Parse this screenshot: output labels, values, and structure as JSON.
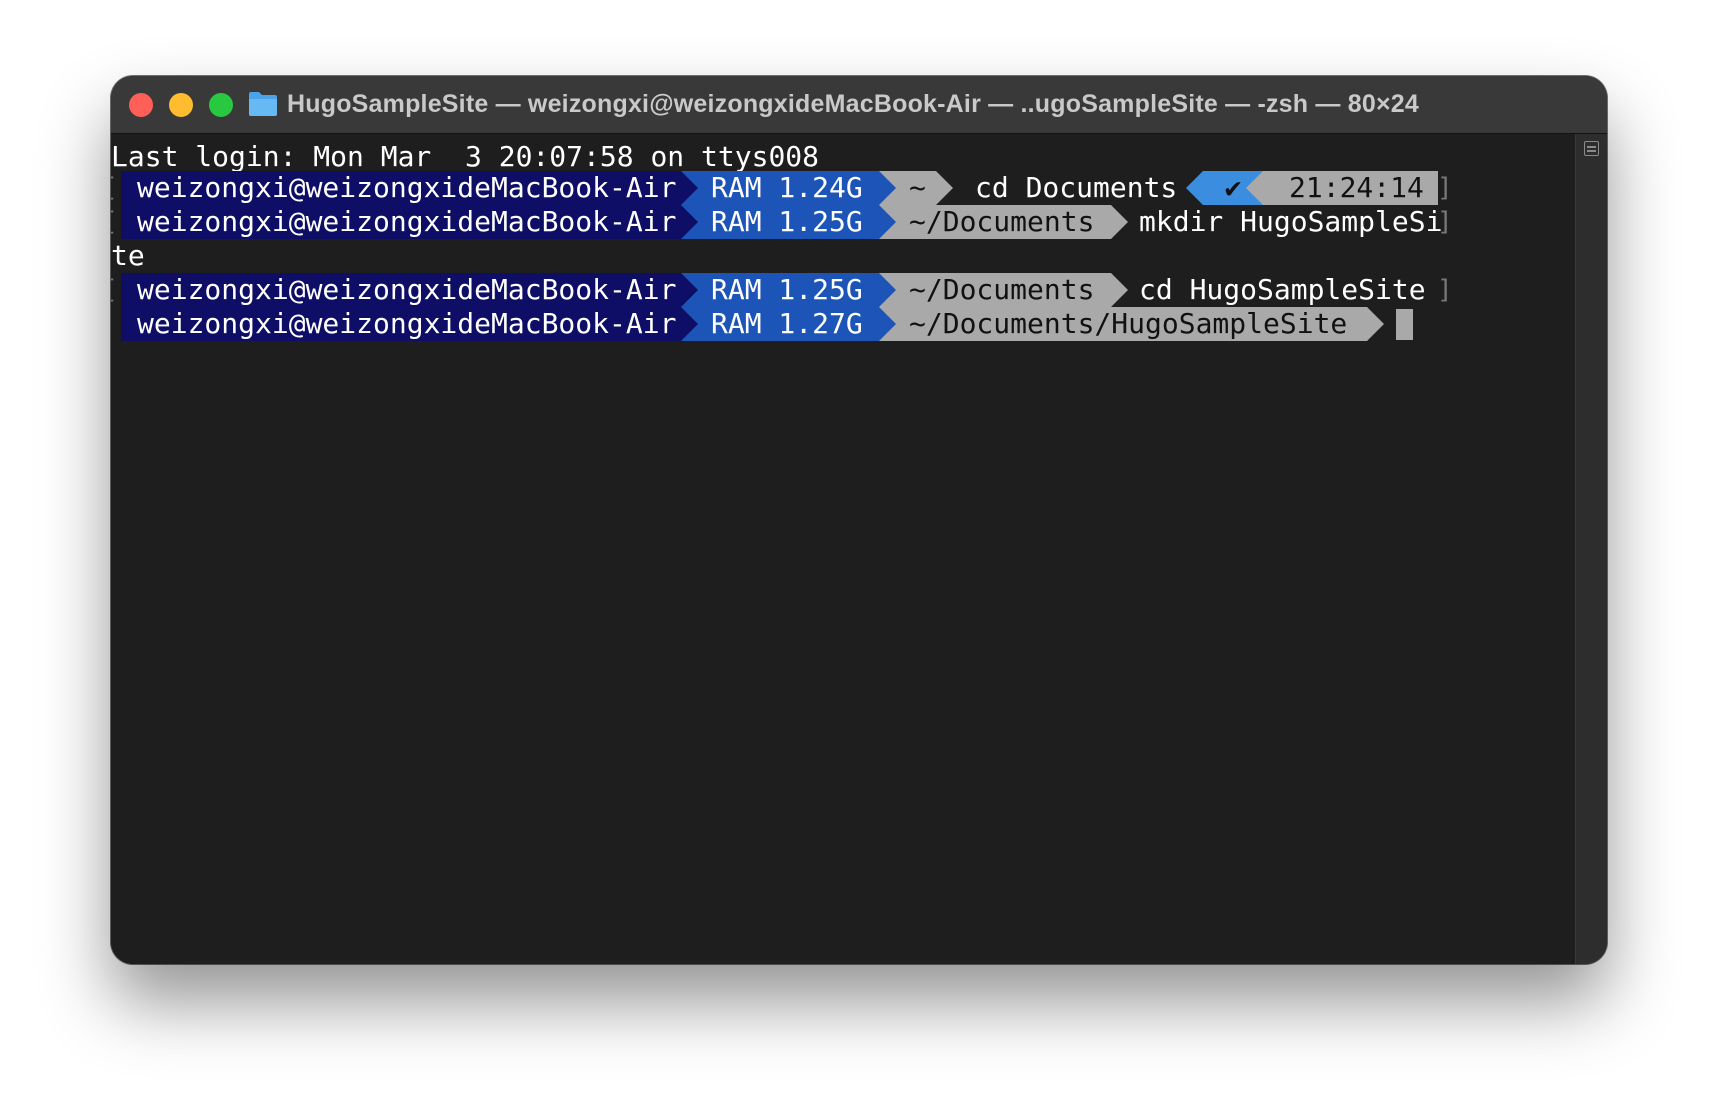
{
  "window": {
    "title": "HugoSampleSite — weizongxi@weizongxideMacBook-Air — ..ugoSampleSite — -zsh — 80×24",
    "title_icon": "folder-icon"
  },
  "colors": {
    "user_segment": "#0e0e66",
    "ram_segment": "#1c55b7",
    "path_segment": "#a9a9a9",
    "status_ok": "#3b8ddf",
    "terminal_bg": "#1e1e1e"
  },
  "terminal": {
    "last_login": "Last login: Mon Mar  3 20:07:58 on ttys008",
    "prompts": [
      {
        "user": "weizongxi@weizongxideMacBook-Air",
        "ram": "RAM 1.24G",
        "path": "~",
        "command": "cd Documents",
        "status": "✔",
        "time": "21:24:14"
      },
      {
        "user": "weizongxi@weizongxideMacBook-Air",
        "ram": "RAM 1.25G",
        "path": "~/Documents",
        "command": "mkdir HugoSampleSi",
        "wrap": "te"
      },
      {
        "user": "weizongxi@weizongxideMacBook-Air",
        "ram": "RAM 1.25G",
        "path": "~/Documents",
        "command": "cd HugoSampleSite"
      },
      {
        "user": "weizongxi@weizongxideMacBook-Air",
        "ram": "RAM 1.27G",
        "path": "~/Documents/HugoSampleSite"
      }
    ],
    "brackets": {
      "open": "[",
      "close": "]"
    }
  }
}
